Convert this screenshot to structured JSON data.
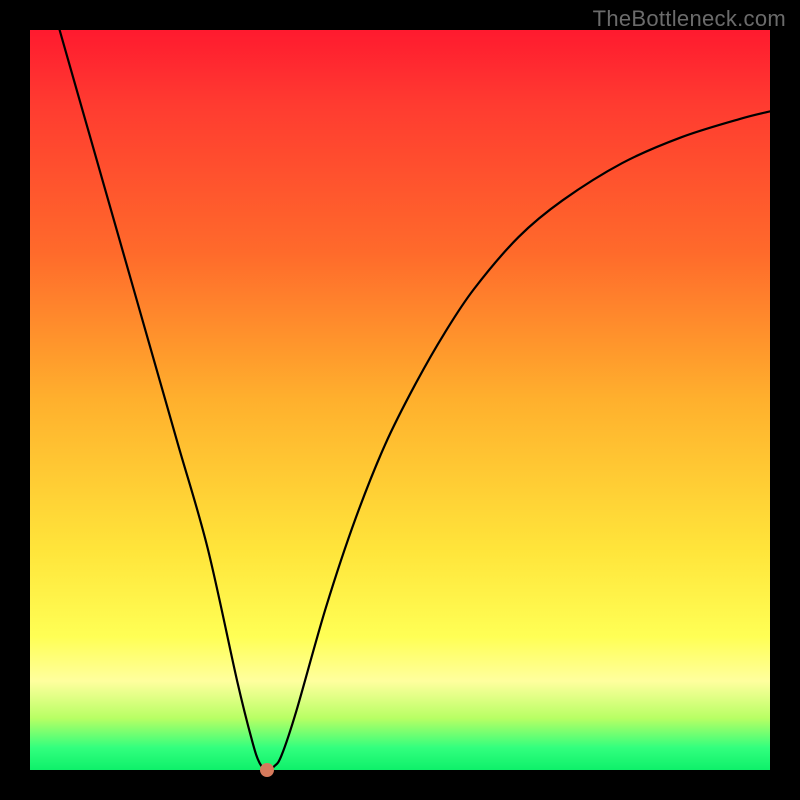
{
  "watermark": {
    "text": "TheBottleneck.com"
  },
  "colors": {
    "frame": "#000000",
    "curve": "#000000",
    "dot": "#d67a5c",
    "gradient_stops": [
      "#ff1a2f",
      "#ff3b30",
      "#ff6a2b",
      "#ffb02d",
      "#ffe43a",
      "#ffff55",
      "#ffff9e",
      "#b8ff64",
      "#32ff7e",
      "#0ef06a"
    ]
  },
  "chart_data": {
    "type": "line",
    "title": "",
    "xlabel": "",
    "ylabel": "",
    "xlim": [
      0,
      100
    ],
    "ylim": [
      0,
      100
    ],
    "grid": false,
    "legend": false,
    "series": [
      {
        "name": "bottleneck-curve",
        "x": [
          4,
          8,
          12,
          16,
          20,
          24,
          28,
          30,
          31,
          32,
          33,
          34,
          36,
          40,
          44,
          48,
          52,
          56,
          60,
          66,
          72,
          80,
          88,
          96,
          100
        ],
        "y": [
          100,
          86,
          72,
          58,
          44,
          30,
          12,
          4,
          1,
          0,
          0.5,
          2,
          8,
          22,
          34,
          44,
          52,
          59,
          65,
          72,
          77,
          82,
          85.5,
          88,
          89
        ]
      }
    ],
    "marker": {
      "x": 32,
      "y": 0
    },
    "notes": "Axes have no tick labels; values are read off by proportional position inside the gradient plot area."
  }
}
